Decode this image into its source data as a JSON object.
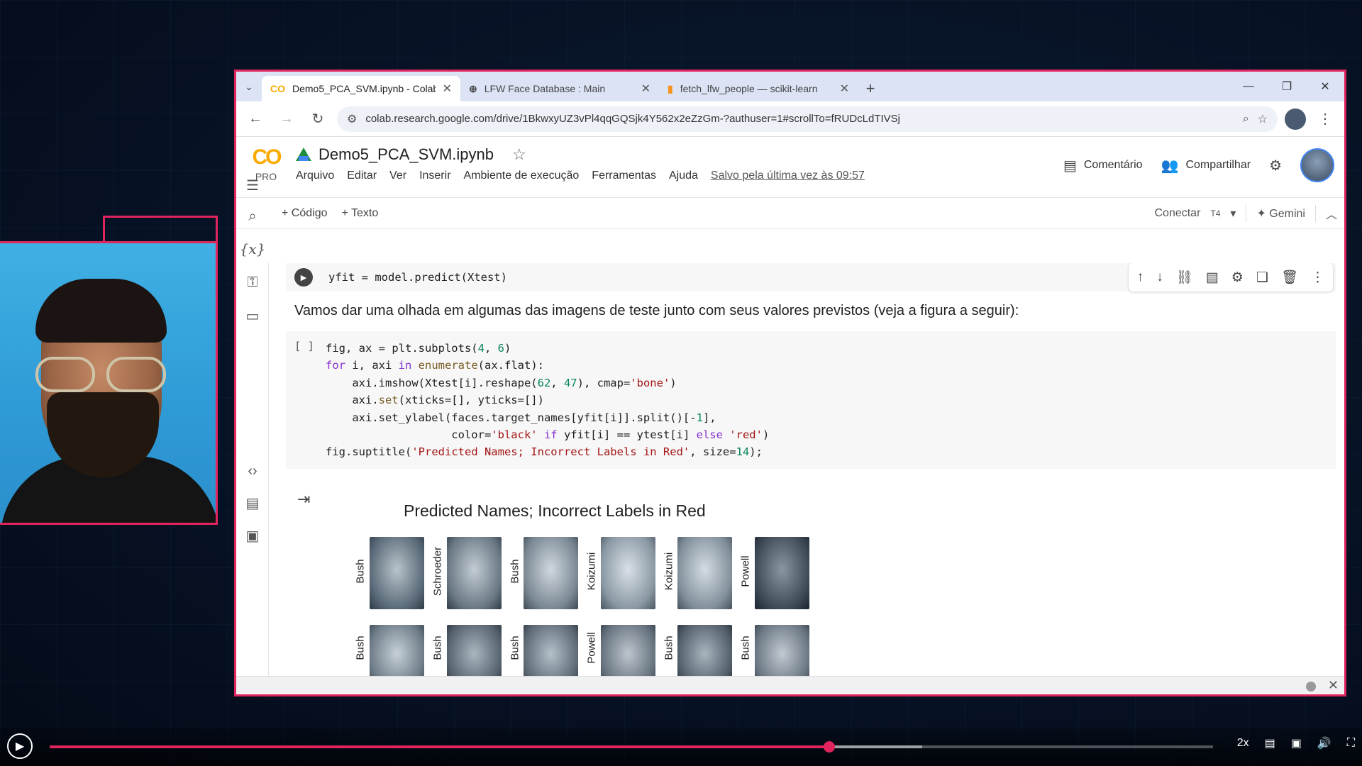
{
  "browser": {
    "tabs": [
      {
        "title": "Demo5_PCA_SVM.ipynb - Colab",
        "favicon": "colab-icon",
        "active": true
      },
      {
        "title": "LFW Face Database : Main",
        "favicon": "globe-icon",
        "active": false
      },
      {
        "title": "fetch_lfw_people — scikit-learn",
        "favicon": "sklearn-icon",
        "active": false
      }
    ],
    "url": "colab.research.google.com/drive/1BkwxyUZ3vPl4qqGQSjk4Y562x2eZzGm-?authuser=1#scrollTo=fRUDcLdTIVSj"
  },
  "colab": {
    "logo_text": "CO",
    "pro_label": "PRO",
    "notebook_title": "Demo5_PCA_SVM.ipynb",
    "menu": [
      "Arquivo",
      "Editar",
      "Ver",
      "Inserir",
      "Ambiente de execução",
      "Ferramentas",
      "Ajuda"
    ],
    "saved_text": "Salvo pela última vez às 09:57",
    "comment_label": "Comentário",
    "share_label": "Compartilhar",
    "toolbar": {
      "add_code": "+ Código",
      "add_text": "+ Texto",
      "connect": "Conectar",
      "runtime": "T4",
      "gemini": "✦ Gemini"
    }
  },
  "cells": {
    "prev_code": "yfit = model.predict(Xtest)",
    "markdown": "Vamos dar uma olhada em algumas das imagens de teste junto com seus valores previstos (veja a figura a seguir):",
    "exec_bracket": "[ ]",
    "figure_title": "Predicted Names; Incorrect Labels in Red",
    "face_labels_row1": [
      "Bush",
      "Schroeder",
      "Bush",
      "Koizumi",
      "Koizumi",
      "Powell"
    ],
    "face_labels_row2": [
      "Bush",
      "Bush",
      "Bush",
      "Powell",
      "Bush",
      "Bush"
    ]
  },
  "player": {
    "progress": 0.67,
    "buffered": 0.75,
    "speed": "2x"
  }
}
